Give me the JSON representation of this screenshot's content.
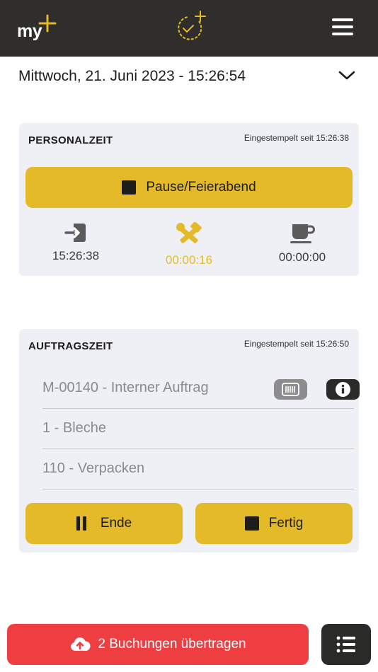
{
  "header": {
    "logo_text": "my",
    "brand_color": "#e4ba28",
    "bar_color": "#2f2e2c"
  },
  "date_row": {
    "datetime": "Mittwoch, 21. Juni 2023 - 15:26:54"
  },
  "personalzeit": {
    "title": "PERSONALZEIT",
    "status": "Eingestempelt seit 15:26:38",
    "button_label": "Pause/Feierabend",
    "stats": [
      {
        "icon": "sign-in-icon",
        "value": "15:26:38"
      },
      {
        "icon": "tools-icon",
        "value": "00:00:16"
      },
      {
        "icon": "coffee-cup-icon",
        "value": "00:00:00"
      }
    ]
  },
  "auftragszeit": {
    "title": "AUFTRAGSZEIT",
    "status": "Eingestempelt seit 15:26:50",
    "fields": [
      {
        "value": "M-00140 - Interner Auftrag"
      },
      {
        "value": "1 - Bleche"
      },
      {
        "value": "110 - Verpacken"
      }
    ],
    "ende_label": "Ende",
    "fertig_label": "Fertig"
  },
  "footer": {
    "upload_label": "2 Buchungen übertragen",
    "upload_color": "#ef3e42"
  }
}
